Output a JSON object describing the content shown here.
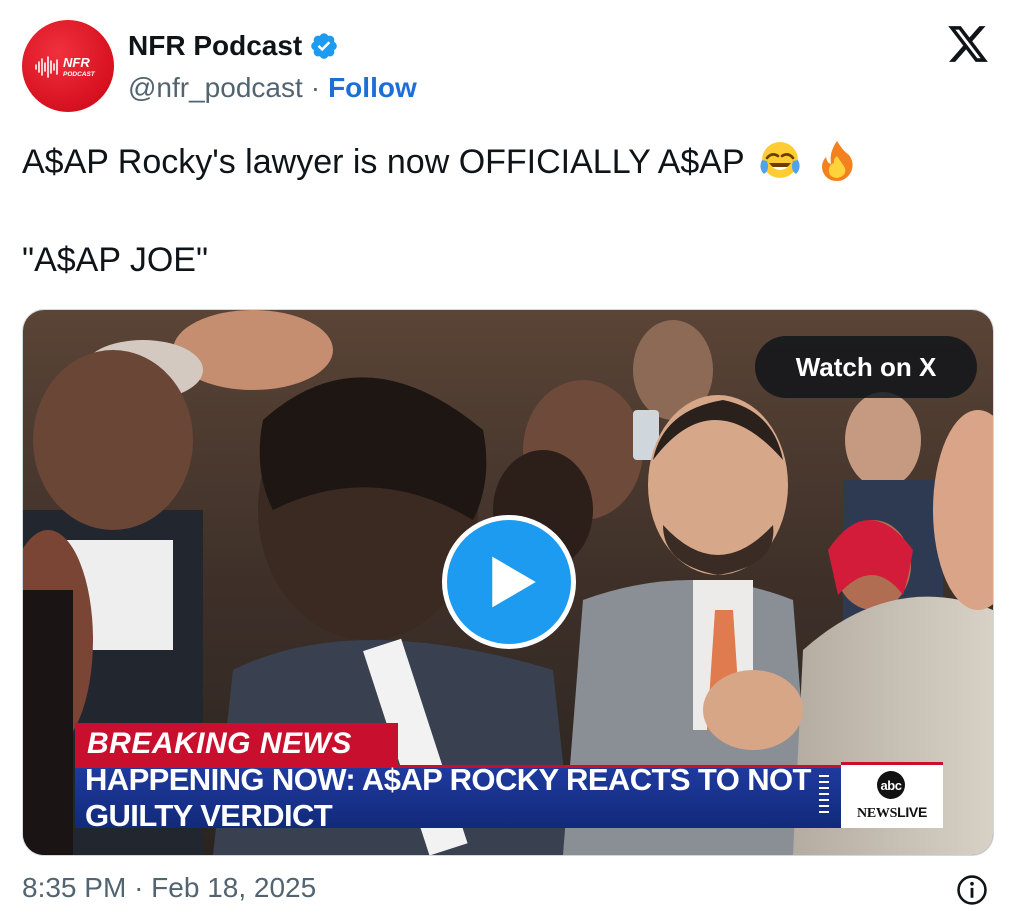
{
  "author": {
    "display_name": "NFR Podcast",
    "handle": "@nfr_podcast",
    "separator": "·",
    "follow_label": "Follow",
    "avatar_text": "NFR",
    "avatar_subtext": "PODCAST",
    "verified_icon": "verified-badge-icon",
    "brand_color": "#d7111f"
  },
  "platform_logo": "x-logo-icon",
  "tweet": {
    "line1": "A$AP Rocky's lawyer is now OFFICIALLY A$AP",
    "line1_emojis": [
      "face-with-tears-of-joy-emoji",
      "fire-emoji"
    ],
    "line2": "\"A$AP JOE\""
  },
  "media": {
    "watch_label": "Watch on X",
    "play_icon": "play-icon",
    "play_color": "#1d9bf0",
    "breaking_label": "BREAKING NEWS",
    "headline": "HAPPENING NOW: A$AP ROCKY REACTS TO NOT GUILTY VERDICT",
    "network_logo_text": "abc",
    "network_label_1": "NEWS",
    "network_label_2": "LIVE"
  },
  "footer": {
    "time": "8:35 PM",
    "separator": "·",
    "date": "Feb 18, 2025",
    "info_icon": "info-icon"
  }
}
